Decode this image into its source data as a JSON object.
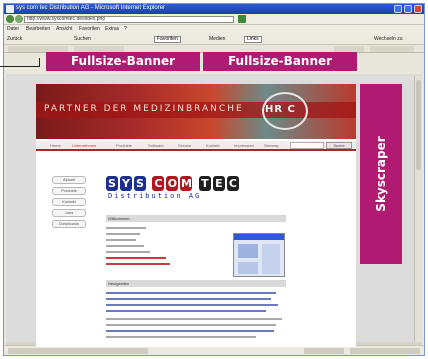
{
  "browser": {
    "title": "sys com tec Distribution AG - Microsoft Internet Explorer",
    "address": "http://www.syscomtec.de/index.php",
    "menu": [
      "Datei",
      "Bearbeiten",
      "Ansicht",
      "Favoriten",
      "Extras",
      "?"
    ],
    "toolbar": [
      "Zurück",
      "Suchen",
      "Favoriten",
      "Medien",
      "Wechseln zu",
      "Links"
    ]
  },
  "ads": {
    "banner_left": "Fullsize-Banner",
    "banner_right": "Fullsize-Banner",
    "skyscraper": "Skyscraper"
  },
  "site": {
    "slogan": "PARTNER DER MEDIZINBRANCHE",
    "hero_logo": "HR C",
    "nav": [
      "Home",
      "Unternehmen",
      "Produkte",
      "Software",
      "Service",
      "Kontakt",
      "Impressum",
      "Sitemap"
    ],
    "search_button": "Suche",
    "side_buttons": [
      "Aktuell",
      "Produkte",
      "Kontakt",
      "Jobs",
      "Downloads"
    ],
    "brand": {
      "sys": [
        "S",
        "Y",
        "S"
      ],
      "com": [
        "C",
        "O",
        "M"
      ],
      "tec": [
        "T",
        "E",
        "C"
      ],
      "tagline": "Distribution AG"
    },
    "section_title_1": "Willkommen",
    "section_title_2": "Neuigkeiten"
  },
  "colors": {
    "ad_magenta": "#b01a72",
    "brand_blue": "#1a2f8f",
    "brand_red": "#b01723",
    "hero_red": "#a52a2a"
  }
}
